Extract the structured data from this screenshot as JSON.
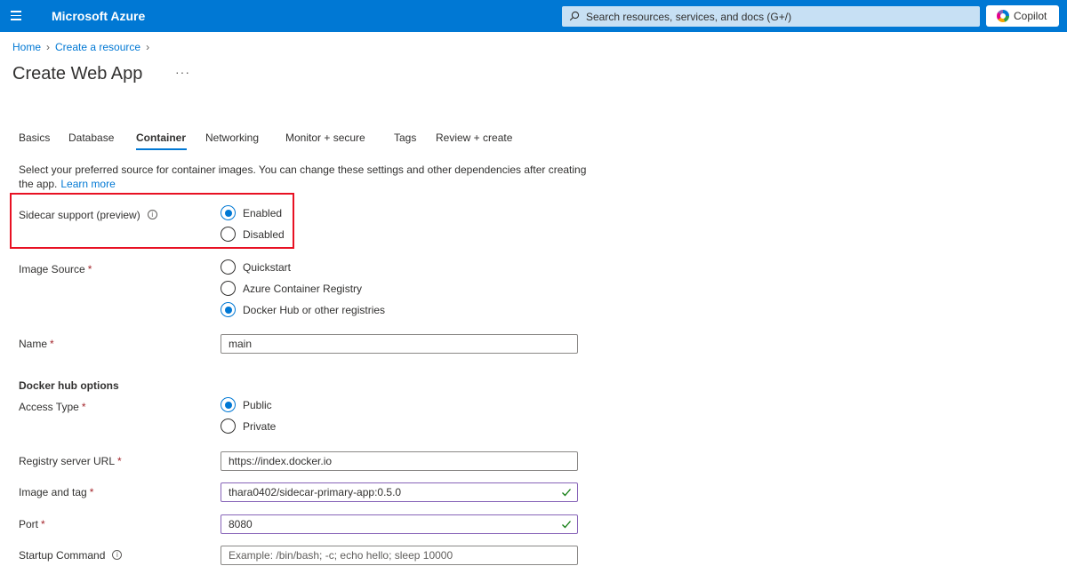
{
  "topbar": {
    "brand": "Microsoft Azure",
    "search_placeholder": "Search resources, services, and docs (G+/)",
    "copilot_label": "Copilot"
  },
  "breadcrumb": [
    "Home",
    "Create a resource"
  ],
  "page": {
    "title": "Create Web App",
    "more": "···"
  },
  "tabs": [
    "Basics",
    "Database",
    "Container",
    "Networking",
    "Monitor + secure",
    "Tags",
    "Review + create"
  ],
  "active_tab": "Container",
  "intro": {
    "text": "Select your preferred source for container images. You can change these settings and other dependencies after creating the app.",
    "link": "Learn more"
  },
  "sidecar": {
    "label": "Sidecar support (preview)",
    "options": [
      "Enabled",
      "Disabled"
    ],
    "selected": "Enabled"
  },
  "image_source": {
    "label": "Image Source",
    "options": [
      "Quickstart",
      "Azure Container Registry",
      "Docker Hub or other registries"
    ],
    "selected": "Docker Hub or other registries"
  },
  "name": {
    "label": "Name",
    "value": "main"
  },
  "docker_hub": {
    "heading": "Docker hub options",
    "access_type": {
      "label": "Access Type",
      "options": [
        "Public",
        "Private"
      ],
      "selected": "Public"
    },
    "registry_url": {
      "label": "Registry server URL",
      "value": "https://index.docker.io"
    },
    "image_tag": {
      "label": "Image and tag",
      "value": "thara0402/sidecar-primary-app:0.5.0"
    },
    "port": {
      "label": "Port",
      "value": "8080"
    },
    "startup": {
      "label": "Startup Command",
      "placeholder": "Example: /bin/bash; -c; echo hello; sleep 10000"
    }
  },
  "required_marker": "*",
  "colors": {
    "accent": "#0078d4",
    "highlight": "#e81123",
    "valid": "#8764b8",
    "check": "#107c10"
  }
}
